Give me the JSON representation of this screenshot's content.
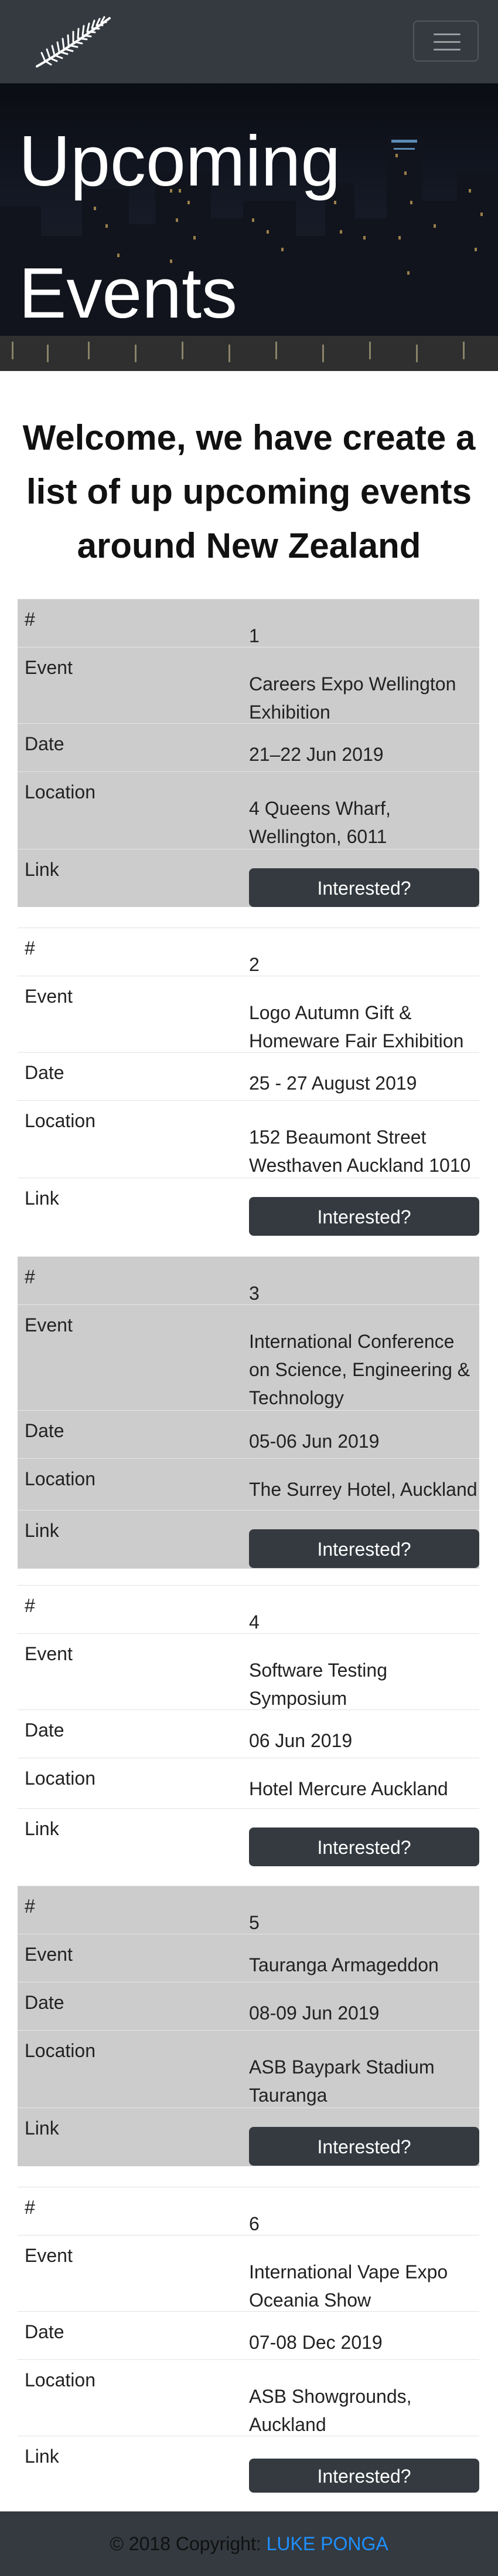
{
  "navbar": {
    "brand_icon": "silver-fern-icon",
    "menu_icon": "hamburger-menu-icon"
  },
  "hero": {
    "title": "Upcoming Events"
  },
  "welcome": {
    "heading": "Welcome, we have create a list of up upcoming events around New Zealand"
  },
  "labels": {
    "number": "#",
    "event": "Event",
    "date": "Date",
    "location": "Location",
    "link": "Link"
  },
  "events": [
    {
      "number": "1",
      "event": "Careers Expo Wellington Exhibition",
      "date": "21–22 Jun 2019",
      "location": "4 Queens Wharf, Wellington, 6011",
      "button": "Interested?"
    },
    {
      "number": "2",
      "event": "Logo Autumn Gift & Homeware Fair Exhibition",
      "date": "25 - 27 August 2019",
      "location": "152 Beaumont Street Westhaven Auckland 1010",
      "button": "Interested?"
    },
    {
      "number": "3",
      "event": "International Conference on Science, Engineering & Technology",
      "date": "05-06 Jun 2019",
      "location": "The Surrey Hotel, Auckland",
      "button": "Interested?"
    },
    {
      "number": "4",
      "event": "Software Testing Symposium",
      "date": "06 Jun 2019",
      "location": "Hotel Mercure Auckland",
      "button": "Interested?"
    },
    {
      "number": "5",
      "event": "Tauranga Armageddon",
      "date": "08-09 Jun 2019",
      "location": "ASB Baypark Stadium Tauranga",
      "button": "Interested?"
    },
    {
      "number": "6",
      "event": "International Vape Expo Oceania Show",
      "date": "07-08 Dec 2019",
      "location": "ASB Showgrounds, Auckland",
      "button": "Interested?"
    }
  ],
  "footer": {
    "copyright": "© 2018 Copyright:",
    "author": "LUKE PONGA"
  },
  "colors": {
    "navbar": "#343a40",
    "shaded_row": "#cccccc",
    "button": "#343a40",
    "footer_link": "#1e90ff"
  }
}
